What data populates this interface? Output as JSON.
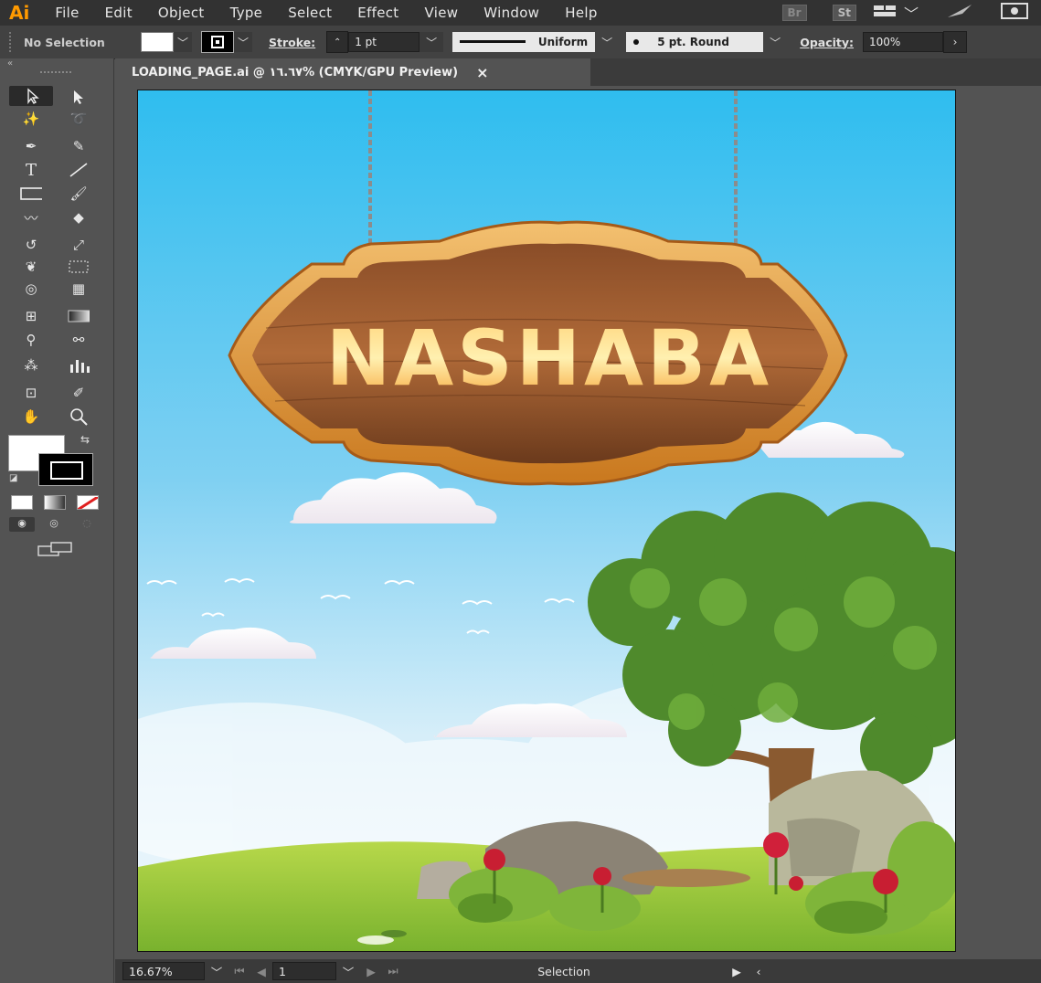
{
  "app": {
    "logo": "Ai"
  },
  "menu": [
    "File",
    "Edit",
    "Object",
    "Type",
    "Select",
    "Effect",
    "View",
    "Window",
    "Help"
  ],
  "menu_right": {
    "bridge": "Br",
    "stock": "St"
  },
  "control": {
    "selection_label": "No Selection",
    "stroke_label": "Stroke:",
    "stroke_weight": "1 pt",
    "profile": "Uniform",
    "brush": "5 pt. Round",
    "opacity_label": "Opacity:",
    "opacity_value": "100%"
  },
  "document": {
    "tab_title": "LOADING_PAGE.ai @ ١٦.٦٧% (CMYK/GPU Preview)",
    "close": "×",
    "sign_text": "NASHABA"
  },
  "status": {
    "zoom": "16.67%",
    "page": "1",
    "tool_name": "Selection"
  },
  "colors": {
    "accent_logo": "#ff9a00",
    "sky_top": "#2fbdef",
    "wood": "#7a4322",
    "frame": "#e8a040"
  }
}
